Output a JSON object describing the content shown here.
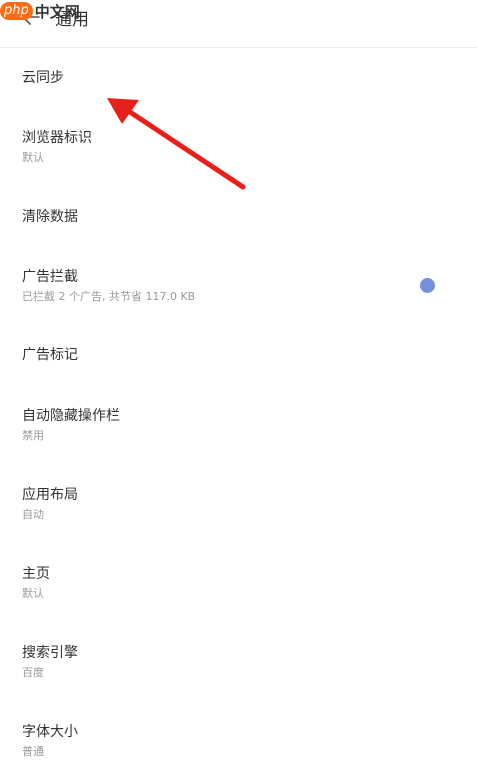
{
  "watermark": {
    "badge": "php",
    "text": "中文网"
  },
  "header": {
    "title": "通用",
    "back_icon": "arrow-left-icon"
  },
  "settings": [
    {
      "title": "云同步",
      "subtitle": ""
    },
    {
      "title": "浏览器标识",
      "subtitle": "默认"
    },
    {
      "title": "清除数据",
      "subtitle": ""
    },
    {
      "title": "广告拦截",
      "subtitle": "已拦截 2 个广告, 共节省 117.0 KB",
      "toggle": true
    },
    {
      "title": "广告标记",
      "subtitle": ""
    },
    {
      "title": "自动隐藏操作栏",
      "subtitle": "禁用"
    },
    {
      "title": "应用布局",
      "subtitle": "自动"
    },
    {
      "title": "主页",
      "subtitle": "默认"
    },
    {
      "title": "搜索引擎",
      "subtitle": "百度"
    },
    {
      "title": "字体大小",
      "subtitle": "普通"
    }
  ],
  "colors": {
    "toggle_accent": "#7391dd",
    "annotation_arrow": "#e8201b",
    "watermark_badge": "#ff6a13"
  }
}
